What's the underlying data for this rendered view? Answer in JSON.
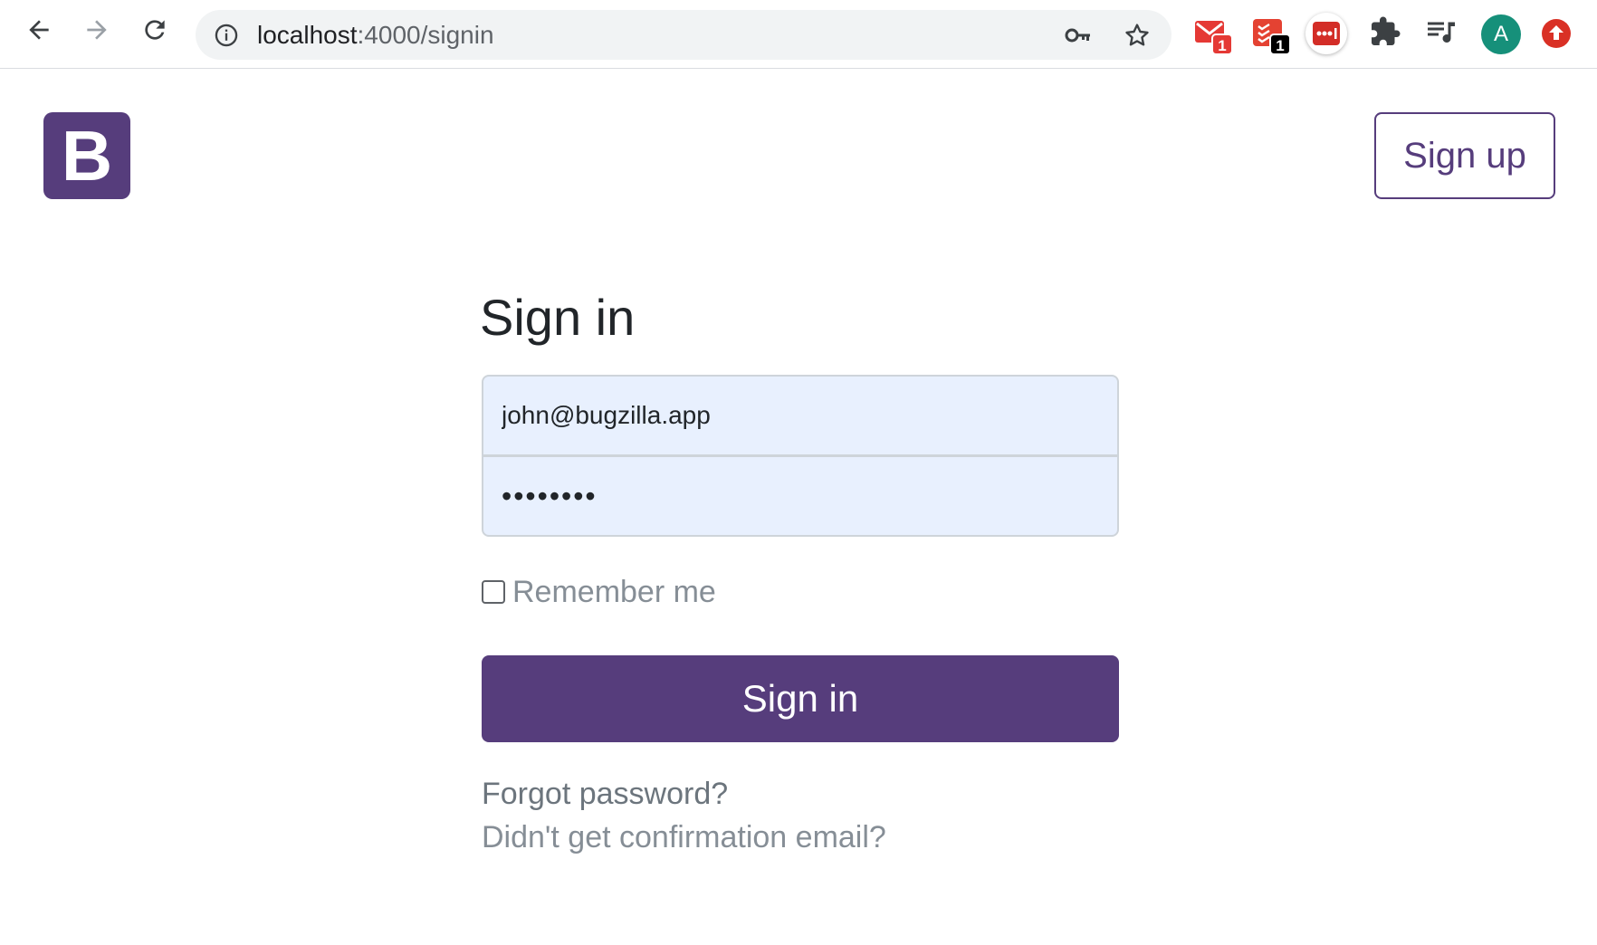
{
  "browser": {
    "url_host": "localhost",
    "url_path": ":4000/signin",
    "extensions": [
      {
        "icon": "gmail-icon",
        "badge": "1",
        "badge_color": "#e53935"
      },
      {
        "icon": "todoist-icon",
        "badge": "1",
        "badge_color": "#000000"
      },
      {
        "icon": "lastpass-icon"
      },
      {
        "icon": "puzzle-icon"
      },
      {
        "icon": "media-queue-icon"
      }
    ],
    "profile_initial": "A"
  },
  "header": {
    "logo_letter": "B",
    "signup_label": "Sign up"
  },
  "form": {
    "title": "Sign in",
    "email_value": "john@bugzilla.app",
    "password_value": "••••••••",
    "remember_label": "Remember me",
    "submit_label": "Sign in",
    "forgot_link": "Forgot password?",
    "confirm_link": "Didn't get confirmation email?"
  },
  "colors": {
    "brand": "#563d7c",
    "autofill_bg": "#e8f0fe"
  }
}
